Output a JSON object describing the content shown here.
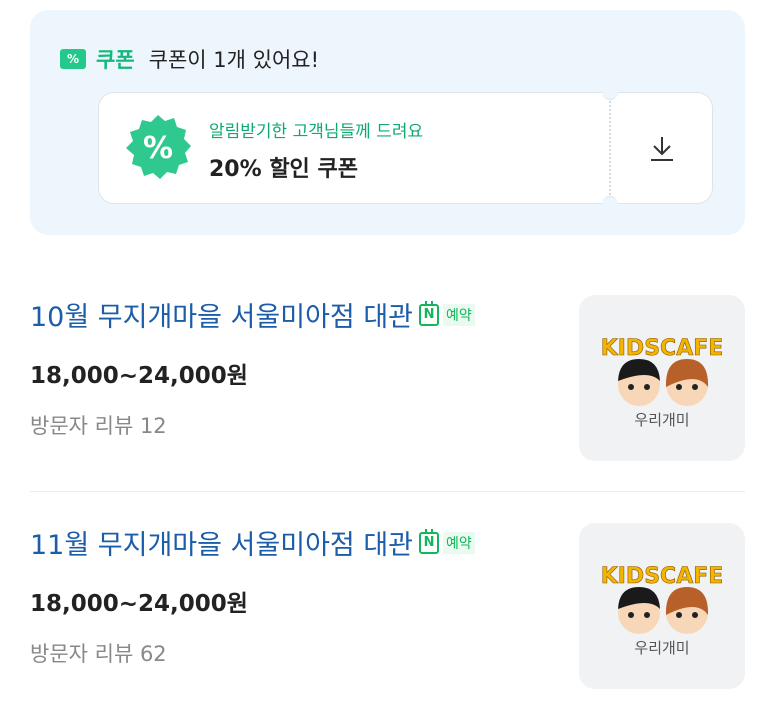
{
  "coupon": {
    "label": "쿠폰",
    "tag_icon_text": "%",
    "count_text": "쿠폰이 1개 있어요!",
    "card": {
      "badge_symbol": "%",
      "subtitle": "알림받기한 고객님들께 드려요",
      "title": "20% 할인 쿠폰",
      "download_icon": "download-icon"
    }
  },
  "items": [
    {
      "title": "10월 무지개마을 서울미아점 대관",
      "booking_icon_text": "N",
      "booking_label": "예약",
      "price": "18,000~24,000원",
      "reviews": "방문자 리뷰 12",
      "thumb": {
        "logo_text": "KIDSCAFE",
        "caption": "우리개미"
      }
    },
    {
      "title": "11월 무지개마을 서울미아점 대관",
      "booking_icon_text": "N",
      "booking_label": "예약",
      "price": "18,000~24,000원",
      "reviews": "방문자 리뷰 62",
      "thumb": {
        "logo_text": "KIDSCAFE",
        "caption": "우리개미"
      }
    }
  ],
  "colors": {
    "accent_green": "#14b87a",
    "link_blue": "#1b5da8",
    "naver_green": "#13b75b",
    "coupon_bg": "#eef6fd"
  }
}
